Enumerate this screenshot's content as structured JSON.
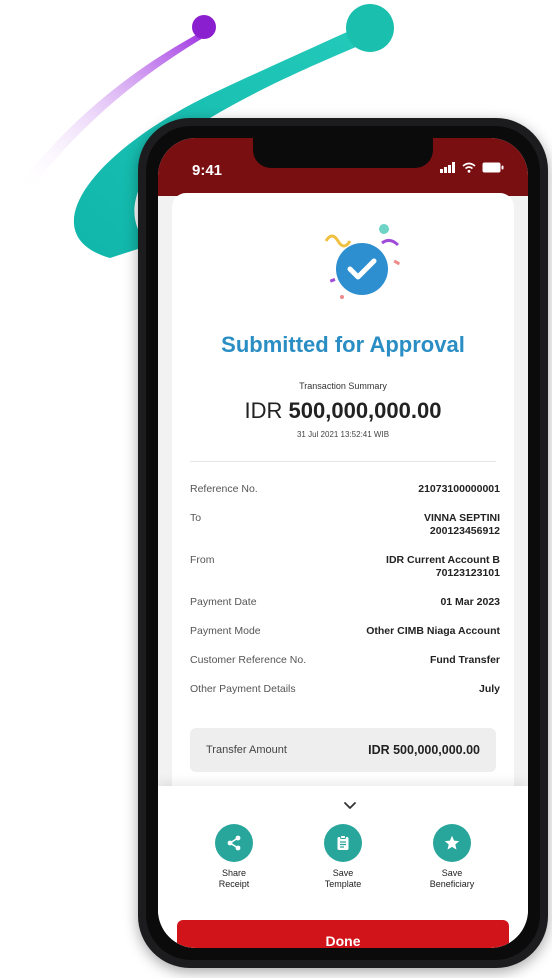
{
  "status_bar": {
    "time": "9:41"
  },
  "result": {
    "title": "Submitted for Approval",
    "summary_label": "Transaction Summary",
    "currency": "IDR",
    "amount": "500,000,000.00",
    "datetime": "31 Jul 2021 13:52:41 WIB"
  },
  "details": [
    {
      "label": "Reference No.",
      "value_line1": "21073100000001",
      "value_line2": ""
    },
    {
      "label": "To",
      "value_line1": "VINNA SEPTINI",
      "value_line2": "200123456912"
    },
    {
      "label": "From",
      "value_line1": "IDR Current Account B",
      "value_line2": "70123123101"
    },
    {
      "label": "Payment Date",
      "value_line1": "01 Mar 2023",
      "value_line2": ""
    },
    {
      "label": "Payment Mode",
      "value_line1": "Other CIMB Niaga Account",
      "value_line2": ""
    },
    {
      "label": "Customer Reference No.",
      "value_line1": "Fund Transfer",
      "value_line2": ""
    },
    {
      "label": "Other Payment Details",
      "value_line1": "July",
      "value_line2": ""
    }
  ],
  "total": {
    "label": "Transfer Amount",
    "value": "IDR 500,000,000.00"
  },
  "actions": [
    {
      "line1": "Share",
      "line2": "Receipt",
      "icon": "share-icon"
    },
    {
      "line1": "Save",
      "line2": "Template",
      "icon": "clipboard-icon"
    },
    {
      "line1": "Save",
      "line2": "Beneficiary",
      "icon": "star-icon"
    }
  ],
  "done_label": "Done",
  "colors": {
    "header": "#7a0f12",
    "title": "#2a8ec4",
    "action": "#28a69b",
    "done": "#d01419",
    "decor_teal": "#1bbfae",
    "decor_purple": "#8a1fd0"
  }
}
